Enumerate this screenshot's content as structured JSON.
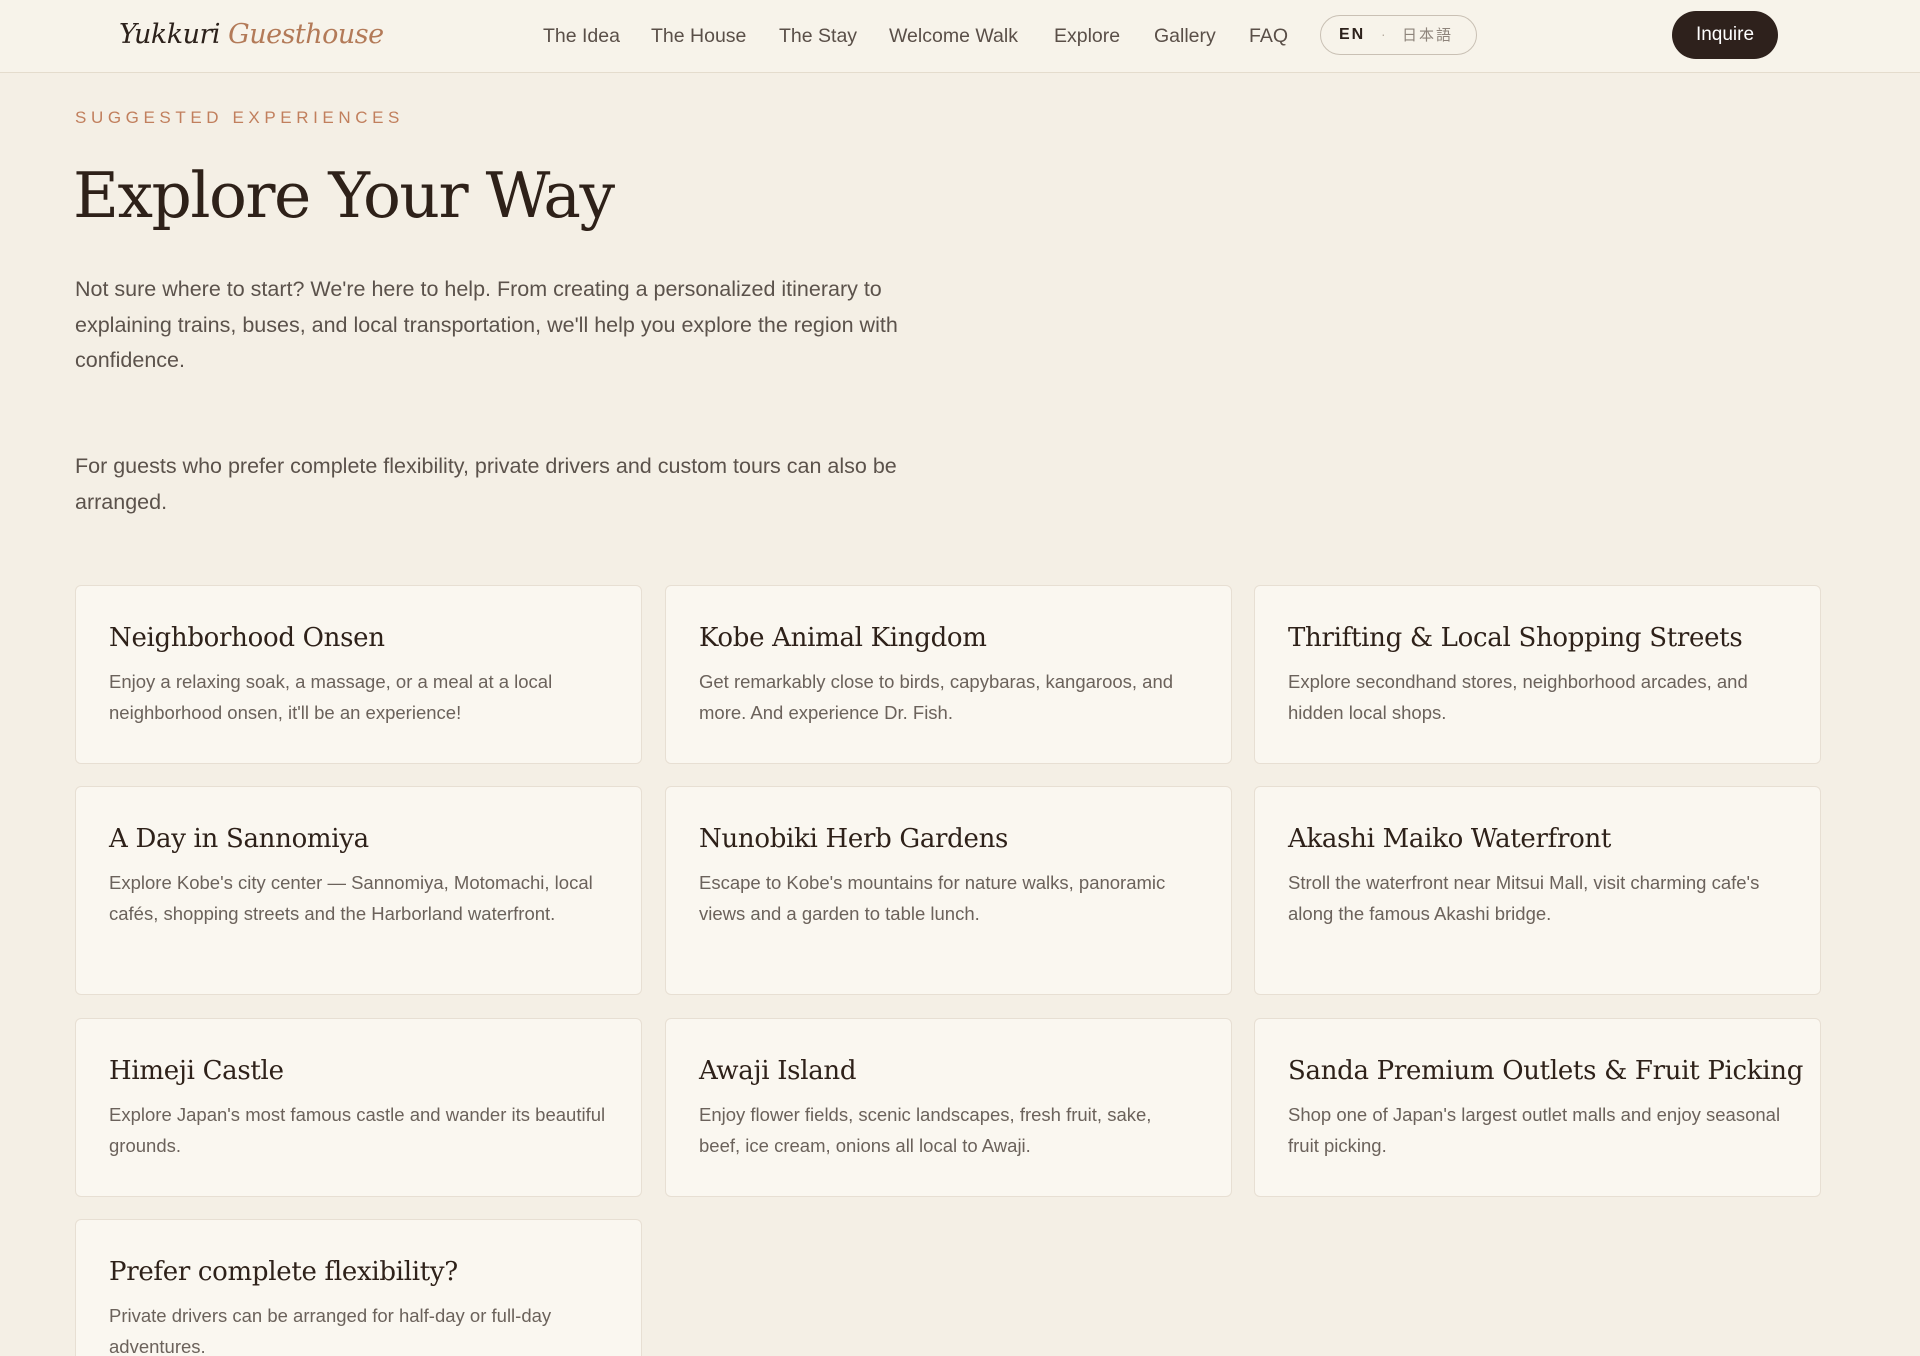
{
  "header": {
    "brand_part1": "Yukkuri",
    "brand_part2": "Guesthouse",
    "nav": [
      {
        "label": "The Idea"
      },
      {
        "label": "The House"
      },
      {
        "label": "The Stay"
      },
      {
        "label": "Welcome Walk"
      },
      {
        "label": "Explore"
      },
      {
        "label": "Gallery"
      },
      {
        "label": "FAQ"
      }
    ],
    "lang": {
      "current": "EN",
      "separator": "·",
      "alt": "日本語"
    },
    "cta_label": "Inquire"
  },
  "intro": {
    "eyebrow": "SUGGESTED EXPERIENCES",
    "title": "Explore Your Way",
    "paragraph1": "Not sure where to start? We're here to help. From creating a personalized itinerary to explaining trains, buses, and local transportation, we'll help you explore the region with confidence.",
    "paragraph2": "For guests who prefer complete flexibility, private drivers and custom tours can also be arranged."
  },
  "cards": [
    {
      "title": "Neighborhood Onsen",
      "text": "Enjoy a relaxing soak, a massage, or a meal at a local neighborhood onsen, it'll be an experience!"
    },
    {
      "title": "Kobe Animal Kingdom",
      "text": "Get remarkably close to birds, capybaras, kangaroos, and more. And experience Dr. Fish."
    },
    {
      "title": "Thrifting & Local Shopping Streets",
      "text": "Explore secondhand stores, neighborhood arcades, and hidden local shops."
    },
    {
      "title": "A Day in Sannomiya",
      "text": "Explore Kobe's city center — Sannomiya, Motomachi, local cafés, shopping streets and the Harborland waterfront."
    },
    {
      "title": "Nunobiki Herb Gardens",
      "text": "Escape to Kobe's mountains for nature walks, panoramic views and a garden to table lunch."
    },
    {
      "title": "Akashi Maiko Waterfront",
      "text": "Stroll the waterfront near Mitsui Mall, visit charming cafe's along the famous Akashi bridge."
    },
    {
      "title": "Himeji Castle",
      "text": "Explore Japan's most famous castle and wander its beautiful grounds."
    },
    {
      "title": "Awaji Island",
      "text": "Enjoy flower fields, scenic landscapes, fresh fruit, sake, beef, ice cream, onions all local to Awaji."
    },
    {
      "title": "Sanda Premium Outlets & Fruit Picking",
      "text": "Shop one of Japan's largest outlet malls and enjoy seasonal fruit picking."
    },
    {
      "title": "Prefer complete flexibility?",
      "text": "Private drivers can be arranged for half-day or full-day adventures."
    }
  ]
}
